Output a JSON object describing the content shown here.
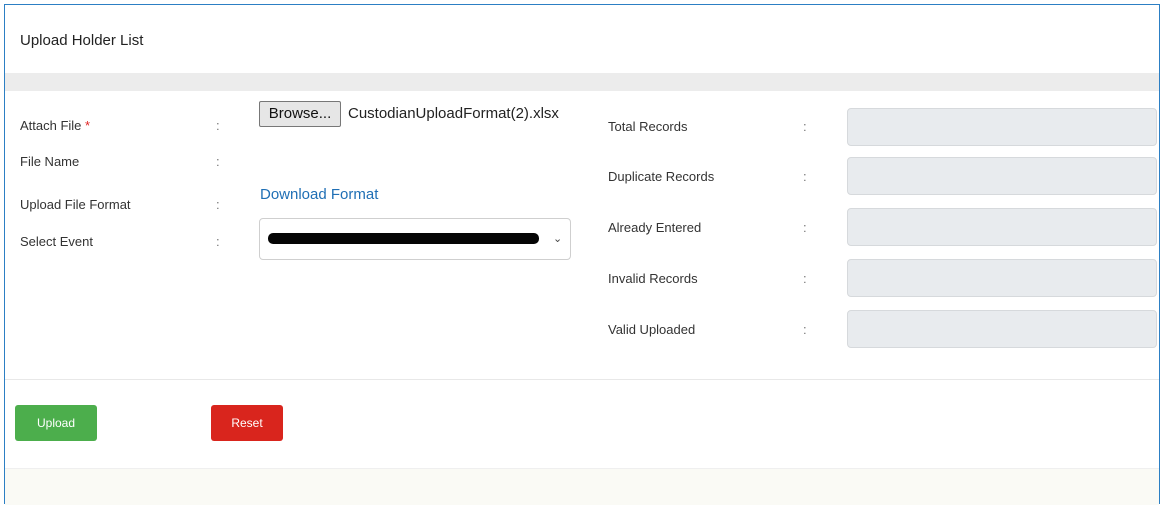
{
  "header": {
    "title": "Upload Holder List"
  },
  "form": {
    "attach_file_label": "Attach File",
    "required_mark": "*",
    "file_name_label": "File Name",
    "upload_format_label": "Upload File Format",
    "select_event_label": "Select Event",
    "separator": ":",
    "browse_label": "Browse...",
    "selected_file": "CustodianUploadFormat(2).xlsx",
    "download_link": "Download Format",
    "select_event_chevron": "⌄"
  },
  "summary": {
    "total_records_label": "Total Records",
    "duplicate_records_label": "Duplicate Records",
    "already_entered_label": "Already Entered",
    "invalid_records_label": "Invalid Records",
    "valid_uploaded_label": "Valid Uploaded",
    "total_records_value": "",
    "duplicate_records_value": "",
    "already_entered_value": "",
    "invalid_records_value": "",
    "valid_uploaded_value": ""
  },
  "actions": {
    "upload_label": "Upload",
    "reset_label": "Reset"
  },
  "colors": {
    "frame_border": "#2c7fc4",
    "upload_bg": "#4cae4c",
    "reset_bg": "#d9251d",
    "link": "#1f6fb5",
    "readonly_field": "#e8ebee"
  }
}
